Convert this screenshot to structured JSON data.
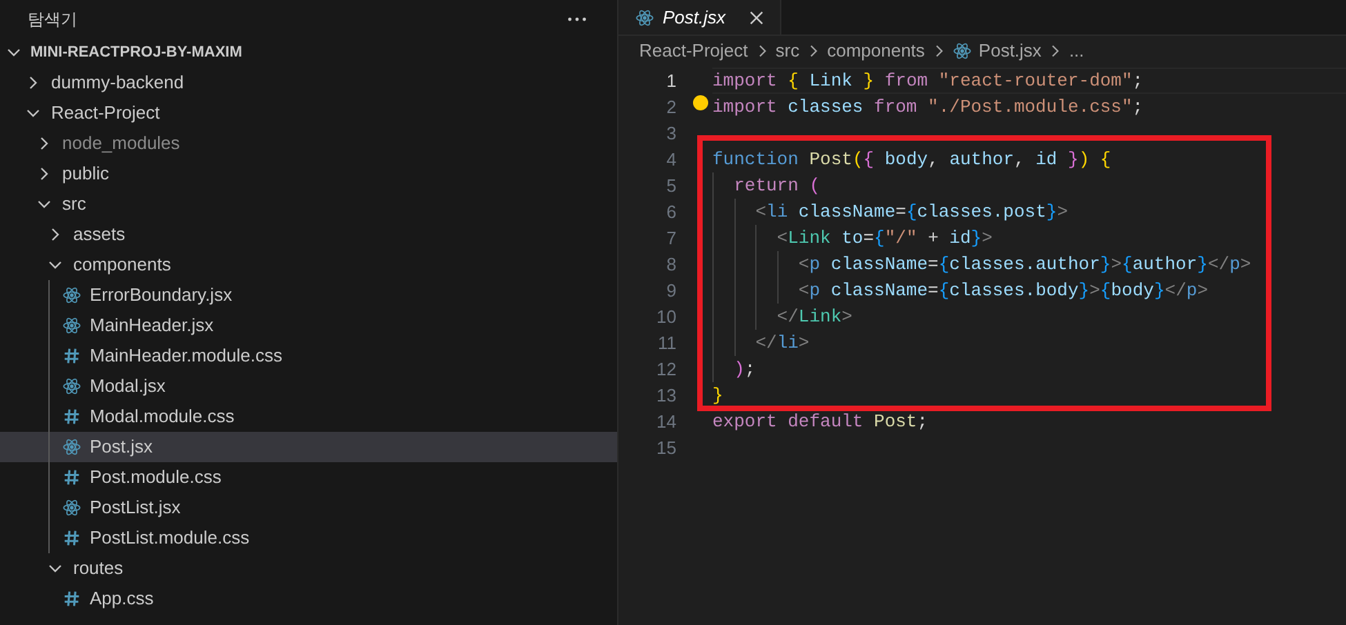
{
  "explorer": {
    "title": "탐색기",
    "tree": {
      "label": "MINI-REACTPROJ-BY-MAXIM",
      "kind": "root",
      "expanded": true,
      "selected": false,
      "ignored": false,
      "children": [
        {
          "label": "dummy-backend",
          "kind": "folder",
          "expanded": false,
          "selected": false,
          "ignored": false
        },
        {
          "label": "React-Project",
          "kind": "folder",
          "expanded": true,
          "selected": false,
          "ignored": false,
          "children": [
            {
              "label": "node_modules",
              "kind": "folder",
              "expanded": false,
              "selected": false,
              "ignored": true
            },
            {
              "label": "public",
              "kind": "folder",
              "expanded": false,
              "selected": false,
              "ignored": false
            },
            {
              "label": "src",
              "kind": "folder",
              "expanded": true,
              "selected": false,
              "ignored": false,
              "children": [
                {
                  "label": "assets",
                  "kind": "folder",
                  "expanded": false,
                  "selected": false,
                  "ignored": false
                },
                {
                  "label": "components",
                  "kind": "folder",
                  "expanded": true,
                  "selected": false,
                  "ignored": false,
                  "children": [
                    {
                      "label": "ErrorBoundary.jsx",
                      "kind": "react",
                      "selected": false,
                      "ignored": false
                    },
                    {
                      "label": "MainHeader.jsx",
                      "kind": "react",
                      "selected": false,
                      "ignored": false
                    },
                    {
                      "label": "MainHeader.module.css",
                      "kind": "css",
                      "selected": false,
                      "ignored": false
                    },
                    {
                      "label": "Modal.jsx",
                      "kind": "react",
                      "selected": false,
                      "ignored": false
                    },
                    {
                      "label": "Modal.module.css",
                      "kind": "css",
                      "selected": false,
                      "ignored": false
                    },
                    {
                      "label": "Post.jsx",
                      "kind": "react",
                      "selected": true,
                      "ignored": false
                    },
                    {
                      "label": "Post.module.css",
                      "kind": "css",
                      "selected": false,
                      "ignored": false
                    },
                    {
                      "label": "PostList.jsx",
                      "kind": "react",
                      "selected": false,
                      "ignored": false
                    },
                    {
                      "label": "PostList.module.css",
                      "kind": "css",
                      "selected": false,
                      "ignored": false
                    }
                  ]
                },
                {
                  "label": "routes",
                  "kind": "folder",
                  "expanded": true,
                  "selected": false,
                  "ignored": false,
                  "children": [
                    {
                      "label": "App.css",
                      "kind": "css",
                      "selected": false,
                      "ignored": false
                    }
                  ]
                }
              ]
            }
          ]
        }
      ]
    }
  },
  "editor": {
    "tabs": [
      {
        "label": "Post.jsx",
        "kind": "react",
        "selected": true,
        "preview": true
      }
    ],
    "breadcrumbs": [
      {
        "label": "React-Project",
        "kind": "folder"
      },
      {
        "label": "src",
        "kind": "folder"
      },
      {
        "label": "components",
        "kind": "folder"
      },
      {
        "label": "Post.jsx",
        "kind": "react"
      },
      {
        "label": "...",
        "kind": "more"
      }
    ],
    "blocks": [
      {
        "framed": false,
        "lines": [
          {
            "number": "1",
            "active": true,
            "lightbulb": false,
            "tokens": [
              {
                "kind": "kw",
                "text": "import "
              },
              {
                "kind": "b1",
                "text": "{ "
              },
              {
                "kind": "var",
                "text": "Link "
              },
              {
                "kind": "b1",
                "text": "} "
              },
              {
                "kind": "kw",
                "text": "from "
              },
              {
                "kind": "str",
                "text": "\"react-router-dom\""
              },
              {
                "kind": "plain",
                "text": ";"
              }
            ]
          },
          {
            "number": "2",
            "active": false,
            "lightbulb": true,
            "tokens": [
              {
                "kind": "kw",
                "text": "import "
              },
              {
                "kind": "var",
                "text": "classes "
              },
              {
                "kind": "kw",
                "text": "from "
              },
              {
                "kind": "str",
                "text": "\"./Post.module.css\""
              },
              {
                "kind": "plain",
                "text": ";"
              }
            ]
          },
          {
            "number": "3",
            "active": false,
            "lightbulb": false
          }
        ]
      },
      {
        "framed": true,
        "lines": [
          {
            "number": "4",
            "active": false,
            "lightbulb": false,
            "tokens": [
              {
                "kind": "storage",
                "text": "function "
              },
              {
                "kind": "fname",
                "text": "Post"
              },
              {
                "kind": "b1",
                "text": "("
              },
              {
                "kind": "b2",
                "text": "{ "
              },
              {
                "kind": "var",
                "text": "body"
              },
              {
                "kind": "plain",
                "text": ", "
              },
              {
                "kind": "var",
                "text": "author"
              },
              {
                "kind": "plain",
                "text": ", "
              },
              {
                "kind": "var",
                "text": "id "
              },
              {
                "kind": "b2",
                "text": "}"
              },
              {
                "kind": "b1",
                "text": ") {"
              }
            ]
          },
          {
            "number": "5",
            "active": false,
            "lightbulb": false,
            "tokens": [
              {
                "kind": "kw",
                "text": "  return "
              },
              {
                "kind": "b2",
                "text": "("
              }
            ]
          },
          {
            "number": "6",
            "active": false,
            "lightbulb": false,
            "tokens": [
              {
                "kind": "tagp",
                "text": "    <"
              },
              {
                "kind": "tag",
                "text": "li "
              },
              {
                "kind": "attr",
                "text": "className"
              },
              {
                "kind": "plain",
                "text": "="
              },
              {
                "kind": "b3",
                "text": "{"
              },
              {
                "kind": "var",
                "text": "classes.post"
              },
              {
                "kind": "b3",
                "text": "}"
              },
              {
                "kind": "tagp",
                "text": ">"
              }
            ]
          },
          {
            "number": "7",
            "active": false,
            "lightbulb": false,
            "tokens": [
              {
                "kind": "tagp",
                "text": "      <"
              },
              {
                "kind": "comp",
                "text": "Link "
              },
              {
                "kind": "attr",
                "text": "to"
              },
              {
                "kind": "plain",
                "text": "="
              },
              {
                "kind": "b3",
                "text": "{"
              },
              {
                "kind": "str",
                "text": "\"/\""
              },
              {
                "kind": "plain",
                "text": " + "
              },
              {
                "kind": "var",
                "text": "id"
              },
              {
                "kind": "b3",
                "text": "}"
              },
              {
                "kind": "tagp",
                "text": ">"
              }
            ]
          },
          {
            "number": "8",
            "active": false,
            "lightbulb": false,
            "tokens": [
              {
                "kind": "tagp",
                "text": "        <"
              },
              {
                "kind": "tag",
                "text": "p "
              },
              {
                "kind": "attr",
                "text": "className"
              },
              {
                "kind": "plain",
                "text": "="
              },
              {
                "kind": "b3",
                "text": "{"
              },
              {
                "kind": "var",
                "text": "classes.author"
              },
              {
                "kind": "b3",
                "text": "}"
              },
              {
                "kind": "tagp",
                "text": ">"
              },
              {
                "kind": "b3",
                "text": "{"
              },
              {
                "kind": "var",
                "text": "author"
              },
              {
                "kind": "b3",
                "text": "}"
              },
              {
                "kind": "tagp",
                "text": "</"
              },
              {
                "kind": "tag",
                "text": "p"
              },
              {
                "kind": "tagp",
                "text": ">"
              }
            ]
          },
          {
            "number": "9",
            "active": false,
            "lightbulb": false,
            "tokens": [
              {
                "kind": "tagp",
                "text": "        <"
              },
              {
                "kind": "tag",
                "text": "p "
              },
              {
                "kind": "attr",
                "text": "className"
              },
              {
                "kind": "plain",
                "text": "="
              },
              {
                "kind": "b3",
                "text": "{"
              },
              {
                "kind": "var",
                "text": "classes.body"
              },
              {
                "kind": "b3",
                "text": "}"
              },
              {
                "kind": "tagp",
                "text": ">"
              },
              {
                "kind": "b3",
                "text": "{"
              },
              {
                "kind": "var",
                "text": "body"
              },
              {
                "kind": "b3",
                "text": "}"
              },
              {
                "kind": "tagp",
                "text": "</"
              },
              {
                "kind": "tag",
                "text": "p"
              },
              {
                "kind": "tagp",
                "text": ">"
              }
            ]
          },
          {
            "number": "10",
            "active": false,
            "lightbulb": false,
            "tokens": [
              {
                "kind": "tagp",
                "text": "      </"
              },
              {
                "kind": "comp",
                "text": "Link"
              },
              {
                "kind": "tagp",
                "text": ">"
              }
            ]
          },
          {
            "number": "11",
            "active": false,
            "lightbulb": false,
            "tokens": [
              {
                "kind": "tagp",
                "text": "    </"
              },
              {
                "kind": "tag",
                "text": "li"
              },
              {
                "kind": "tagp",
                "text": ">"
              }
            ]
          },
          {
            "number": "12",
            "active": false,
            "lightbulb": false,
            "tokens": [
              {
                "kind": "b2",
                "text": "  )"
              },
              {
                "kind": "plain",
                "text": ";"
              }
            ]
          },
          {
            "number": "13",
            "active": false,
            "lightbulb": false,
            "tokens": [
              {
                "kind": "b1",
                "text": "}"
              }
            ]
          }
        ]
      },
      {
        "framed": false,
        "lines": [
          {
            "number": "14",
            "active": false,
            "lightbulb": false,
            "tokens": [
              {
                "kind": "kw",
                "text": "export default "
              },
              {
                "kind": "fname",
                "text": "Post"
              },
              {
                "kind": "plain",
                "text": ";"
              }
            ]
          },
          {
            "number": "15",
            "active": false,
            "lightbulb": false
          }
        ]
      }
    ]
  }
}
